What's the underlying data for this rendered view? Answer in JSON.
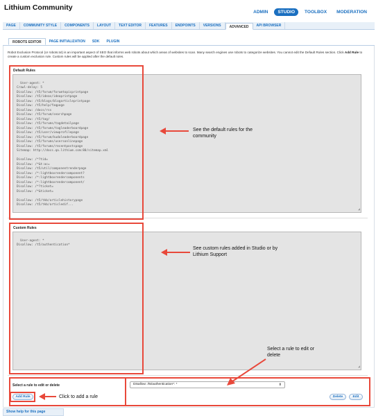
{
  "app": {
    "title": "Lithium Community"
  },
  "top_nav": [
    {
      "label": "ADMIN",
      "active": false
    },
    {
      "label": "STUDIO",
      "active": true
    },
    {
      "label": "TOOLBOX",
      "active": false
    },
    {
      "label": "MODERATION",
      "active": false
    }
  ],
  "main_tabs": [
    {
      "label": "PAGE",
      "active": false
    },
    {
      "label": "COMMUNITY STYLE",
      "active": false
    },
    {
      "label": "COMPONENTS",
      "active": false
    },
    {
      "label": "LAYOUT",
      "active": false
    },
    {
      "label": "TEXT EDITOR",
      "active": false
    },
    {
      "label": "FEATURES",
      "active": false
    },
    {
      "label": "ENDPOINTS",
      "active": false
    },
    {
      "label": "VERSIONS",
      "active": false
    },
    {
      "label": "ADVANCED",
      "active": true
    },
    {
      "label": "API BROWSER",
      "active": false
    }
  ],
  "sub_tabs": [
    {
      "label": "ROBOTS EDITOR",
      "active": true
    },
    {
      "label": "PAGE INITIALIZATION",
      "active": false
    },
    {
      "label": "SDK",
      "active": false
    },
    {
      "label": "PLUGIN",
      "active": false
    }
  ],
  "intro": {
    "part1": "Robot Exclusion Protocol (or robots.txt) is an important aspect of SEO that informs web robots about which areas of websites to scan. Many search engines use robots to categorize websites. You cannot edit the Default Rules section. Click ",
    "bold": "Add Rule",
    "part2": " to create a custom exclusion rule. Custom rules will be applied after the default rules."
  },
  "default_rules": {
    "label": "Default Rules",
    "content": "User-agent: *\nCrawl-delay: 5\nDisallow: /t5/forum/forumtopicprintpage\nDisallow: /t5/ideas/ideaprintpage\nDisallow: /t5/blogs/blogarticleprintpage\nDisallow: /t5/help/faqpage\nDisallow: /docs/rss\nDisallow: /t5/forum/searchpage\nDisallow: /t5/tag/\nDisallow: /t5/forums/tagdetailpage\nDisallow: /t5/forums/tagleaderboardpage\nDisallow: /t5/user/viewprofilepage\nDisallow: /t5/forum/kudoleaderboardpage\nDisallow: /t5/forums/usersonlinepage\nDisallow: /t5/forums/recentpostspage\nSitemap: http://docs.qa.lithium.com:80/sitemap.xml\n\nDisallow: /*?tid=\nDisallow: /*&t:ac=\nDisallow: /t5/util/componentrenderpage\nDisallow: /*:lightboxrendercomponent?\nDisallow: /*:lightboxrendercomponents\nDisallow: /*:lightboxrendercomponent/\nDisallow: /*?ticket=\nDisallow: /*&ticket=\n\nDisallow: /t5/tkb/articlehistorypage\nDisallow: /t5/tkb/articledif..."
  },
  "custom_rules": {
    "label": "Custom Rules",
    "content": "User-agent: *\nDisallow: /t5/authentication*"
  },
  "select_rule": {
    "label": "Select a rule to edit or delete",
    "value": "Disallow: /t5/authentication*: *"
  },
  "buttons": {
    "add_rule": "Add Rule",
    "delete": "Delete",
    "edit": "Edit"
  },
  "help_link": "Show help for this page",
  "annotations": {
    "default_rules": "See the default rules for the community",
    "custom_rules": "See custom rules added in Studio or by Lithium Support",
    "select_rule": "Select a rule to edit or delete",
    "add_rule": "Click to add a rule"
  },
  "colors": {
    "accent": "#1a6fc0",
    "annotation_red": "#e8483a",
    "textarea_bg": "#e4e4e4"
  }
}
